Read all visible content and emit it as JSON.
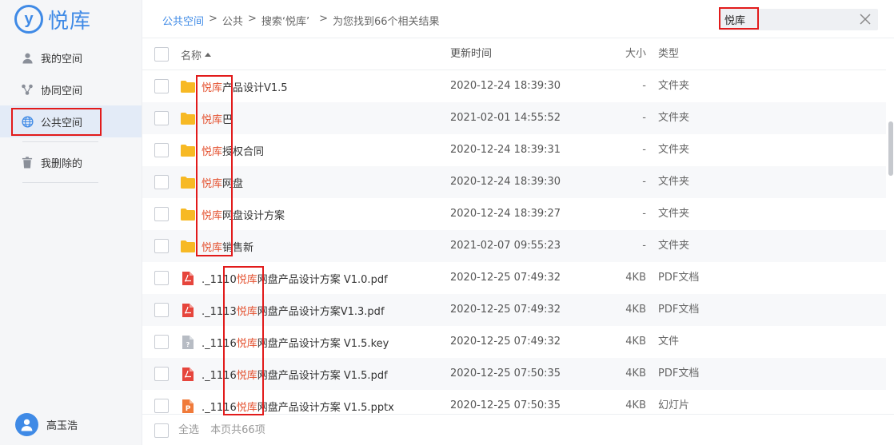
{
  "brand": {
    "logo_glyph": "y",
    "name": "悦库",
    "color": "#3f8ae6"
  },
  "sidebar": {
    "items": [
      {
        "label": "我的空间",
        "icon": "person-icon"
      },
      {
        "label": "协同空间",
        "icon": "share-icon"
      },
      {
        "label": "公共空间",
        "icon": "globe-icon",
        "active": true
      },
      {
        "label": "我删除的",
        "icon": "trash-icon"
      }
    ],
    "user": {
      "name": "高玉浩"
    }
  },
  "breadcrumb": {
    "root": "公共空间",
    "level1": "公共",
    "search": "搜索‘悦库’",
    "result": "为您找到66个相关结果"
  },
  "search": {
    "value": "悦库"
  },
  "table": {
    "headers": {
      "name": "名称",
      "time": "更新时间",
      "size": "大小",
      "type": "类型"
    },
    "rows": [
      {
        "icon": "folder-icon",
        "pre": "",
        "hl": "悦库",
        "post": "产品设计V1.5",
        "time": "2020-12-24 18:39:30",
        "size": "-",
        "type": "文件夹"
      },
      {
        "icon": "folder-icon",
        "pre": "",
        "hl": "悦库",
        "post": "巴",
        "time": "2021-02-01 14:55:52",
        "size": "-",
        "type": "文件夹"
      },
      {
        "icon": "folder-icon",
        "pre": "",
        "hl": "悦库",
        "post": "授权合同",
        "time": "2020-12-24 18:39:31",
        "size": "-",
        "type": "文件夹"
      },
      {
        "icon": "folder-icon",
        "pre": "",
        "hl": "悦库",
        "post": "网盘",
        "time": "2020-12-24 18:39:30",
        "size": "-",
        "type": "文件夹"
      },
      {
        "icon": "folder-icon",
        "pre": "",
        "hl": "悦库",
        "post": "网盘设计方案",
        "time": "2020-12-24 18:39:27",
        "size": "-",
        "type": "文件夹"
      },
      {
        "icon": "folder-icon",
        "pre": "",
        "hl": "悦库",
        "post": "销售新",
        "time": "2021-02-07 09:55:23",
        "size": "-",
        "type": "文件夹"
      },
      {
        "icon": "pdf-icon",
        "pre": "._1110",
        "hl": "悦库",
        "post": "网盘产品设计方案 V1.0.pdf",
        "time": "2020-12-25 07:49:32",
        "size": "4KB",
        "type": "PDF文档"
      },
      {
        "icon": "pdf-icon",
        "pre": "._1113",
        "hl": "悦库",
        "post": "网盘产品设计方案V1.3.pdf",
        "time": "2020-12-25 07:49:32",
        "size": "4KB",
        "type": "PDF文档"
      },
      {
        "icon": "unknown-file-icon",
        "pre": "._1116",
        "hl": "悦库",
        "post": "网盘产品设计方案 V1.5.key",
        "time": "2020-12-25 07:49:32",
        "size": "4KB",
        "type": "文件"
      },
      {
        "icon": "pdf-icon",
        "pre": "._1116",
        "hl": "悦库",
        "post": "网盘产品设计方案 V1.5.pdf",
        "time": "2020-12-25 07:50:35",
        "size": "4KB",
        "type": "PDF文档"
      },
      {
        "icon": "pptx-icon",
        "pre": "._1116",
        "hl": "悦库",
        "post": "网盘产品设计方案 V1.5.pptx",
        "time": "2020-12-25 07:50:35",
        "size": "4KB",
        "type": "幻灯片"
      }
    ]
  },
  "footer": {
    "select_all": "全选",
    "count": "本页共66项"
  },
  "colors": {
    "highlight": "#e4512f",
    "annotation": "#e21b1b",
    "folder": "#f7b924",
    "pdf": "#e6453c",
    "pptx": "#f07a3a"
  }
}
